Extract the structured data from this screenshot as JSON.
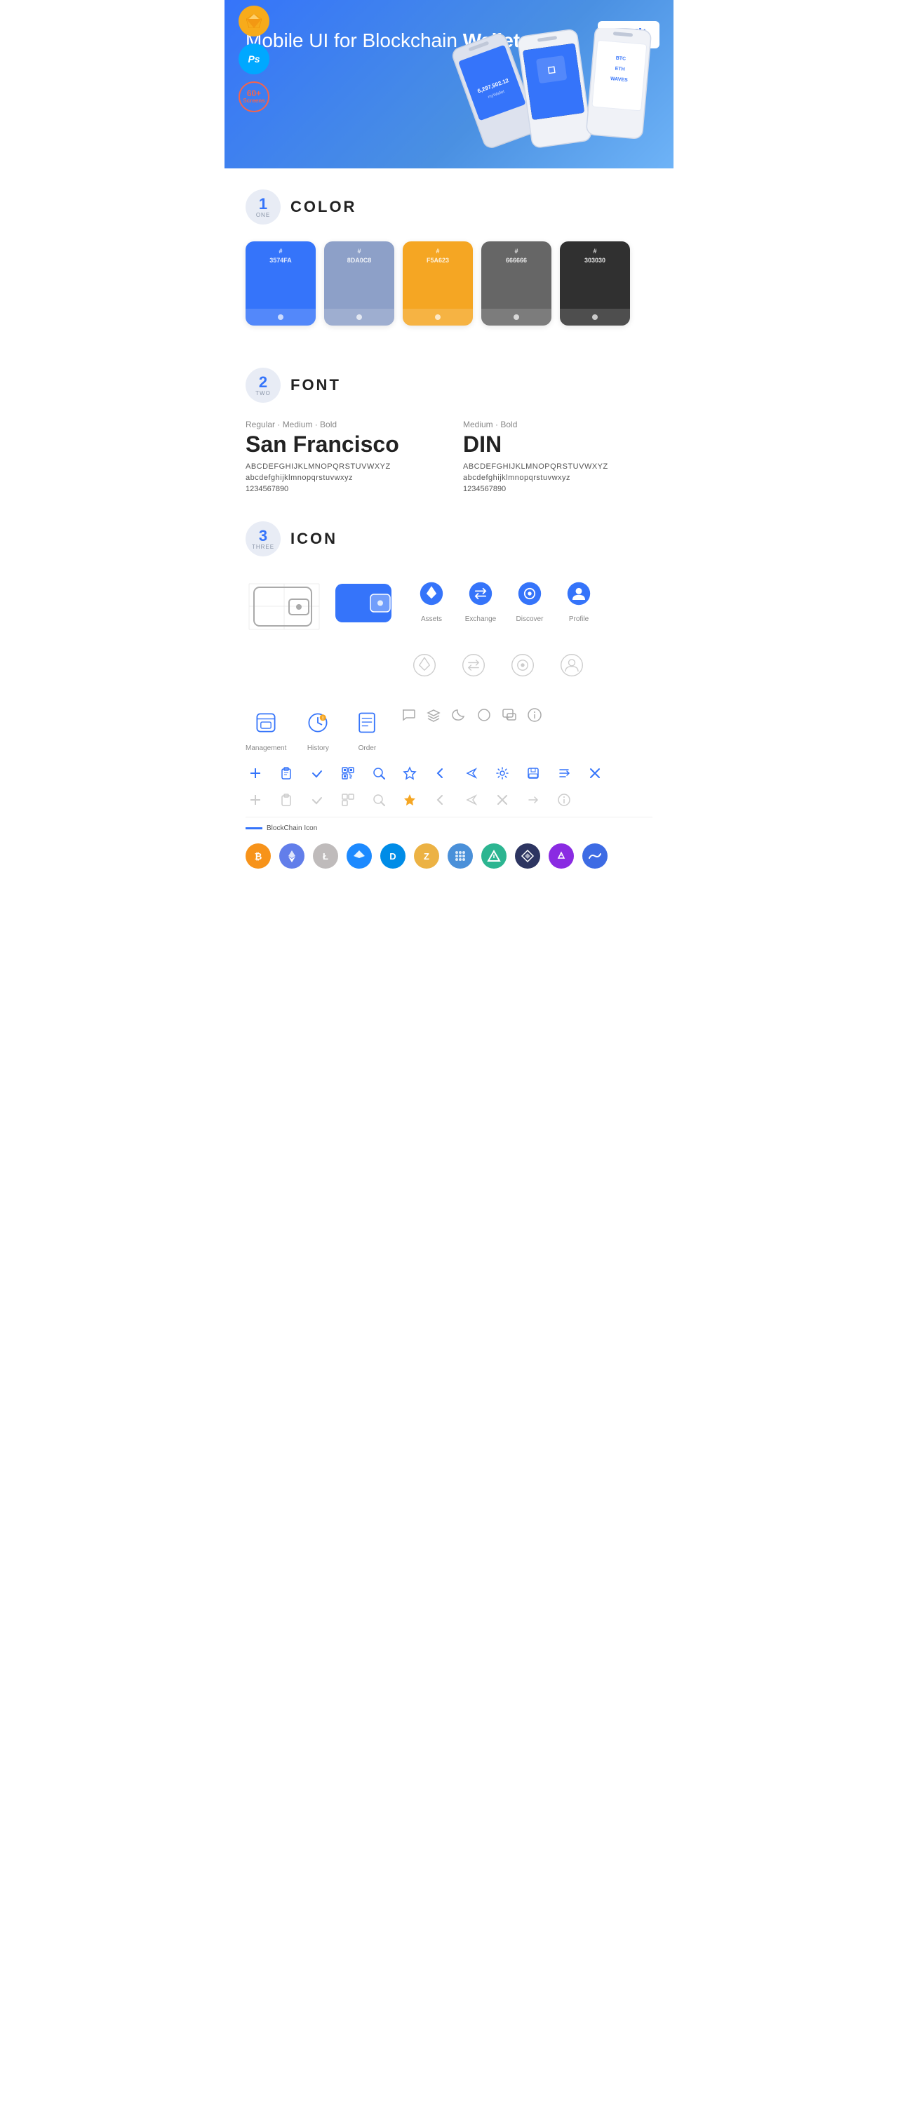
{
  "hero": {
    "title_normal": "Mobile UI for Blockchain ",
    "title_bold": "Wallet",
    "badge": "UI Kit",
    "sketch_label": "Sketch",
    "ps_label": "PS",
    "screens_line1": "60+",
    "screens_line2": "Screens"
  },
  "sections": {
    "color": {
      "number": "1",
      "number_word": "ONE",
      "title": "COLOR",
      "swatches": [
        {
          "hex": "#3574FA",
          "label": "3574FA"
        },
        {
          "hex": "#8DA0C8",
          "label": "8DA0C8"
        },
        {
          "hex": "#F5A623",
          "label": "F5A623"
        },
        {
          "hex": "#666666",
          "label": "666666"
        },
        {
          "hex": "#303030",
          "label": "303030"
        }
      ]
    },
    "font": {
      "number": "2",
      "number_word": "TWO",
      "title": "FONT",
      "fonts": [
        {
          "style_label": "Regular · Medium · Bold",
          "name": "San Francisco",
          "uppercase": "ABCDEFGHIJKLMNOPQRSTUVWXYZ",
          "lowercase": "abcdefghijklmnopqrstuvwxyz",
          "numbers": "1234567890"
        },
        {
          "style_label": "Medium · Bold",
          "name": "DIN",
          "uppercase": "ABCDEFGHIJKLMNOPQRSTUVWXYZ",
          "lowercase": "abcdefghijklmnopqrstuvwxyz",
          "numbers": "1234567890"
        }
      ]
    },
    "icon": {
      "number": "3",
      "number_word": "THREE",
      "title": "ICON",
      "named_icons": [
        {
          "name": "Assets",
          "type": "diamond"
        },
        {
          "name": "Exchange",
          "type": "exchange"
        },
        {
          "name": "Discover",
          "type": "discover"
        },
        {
          "name": "Profile",
          "type": "profile"
        }
      ],
      "bottom_named": [
        {
          "name": "Management",
          "type": "management"
        },
        {
          "name": "History",
          "type": "history"
        },
        {
          "name": "Order",
          "type": "order"
        }
      ],
      "blockchain_label": "BlockChain Icon",
      "cryptos": [
        {
          "symbol": "₿",
          "color": "#F7931A",
          "name": "Bitcoin"
        },
        {
          "symbol": "Ξ",
          "color": "#627EEA",
          "name": "Ethereum"
        },
        {
          "symbol": "Ł",
          "color": "#A6A9AA",
          "name": "Litecoin"
        },
        {
          "symbol": "◆",
          "color": "#1D8AFF",
          "name": "Stratis"
        },
        {
          "symbol": "D",
          "color": "#008CE7",
          "name": "Dash"
        },
        {
          "symbol": "Z",
          "color": "#ECB244",
          "name": "Zcash"
        },
        {
          "symbol": "◎",
          "color": "#4A90D9",
          "name": "POA"
        },
        {
          "symbol": "▲",
          "color": "#5CBA9B",
          "name": "Augur"
        },
        {
          "symbol": "◈",
          "color": "#2D3561",
          "name": "Ethos"
        },
        {
          "symbol": "⬡",
          "color": "#E8007D",
          "name": "Matic"
        },
        {
          "symbol": "~",
          "color": "#3D6BE4",
          "name": "Waves"
        }
      ]
    }
  }
}
